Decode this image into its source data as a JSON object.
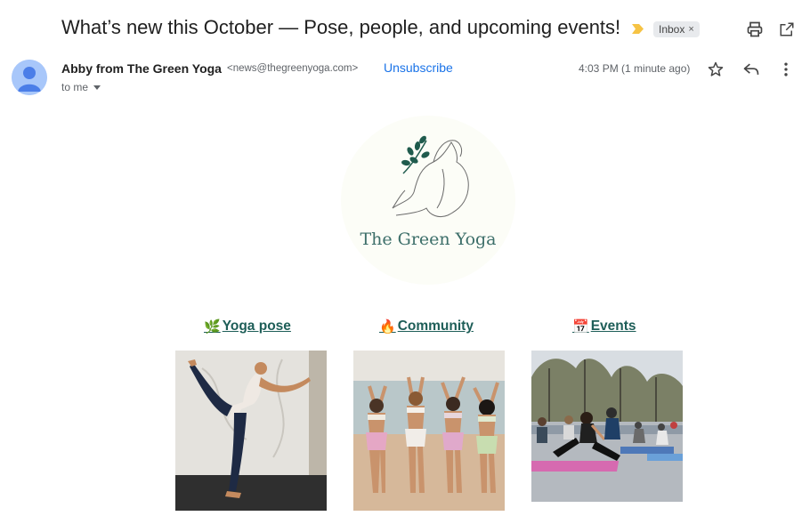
{
  "email": {
    "subject": "What’s new this October — Pose, people, and upcoming events!",
    "label": "Inbox",
    "label_close": "×",
    "sender_name": "Abby from The Green Yoga",
    "sender_email": "<news@thegreenyoga.com>",
    "unsubscribe": "Unsubscribe",
    "recipient": "to me",
    "time": "4:03 PM (1 minute ago)"
  },
  "newsletter": {
    "logo_text": "The Green Yoga",
    "nav": [
      {
        "emoji": "🌿",
        "label": " Yoga pose"
      },
      {
        "emoji": "🔥",
        "label": " Community"
      },
      {
        "emoji": "📅",
        "label": " Events"
      }
    ]
  },
  "colors": {
    "link_blue": "#1a73e8",
    "brand_green": "#1e5e58",
    "importance_marker": "#f6c344"
  }
}
